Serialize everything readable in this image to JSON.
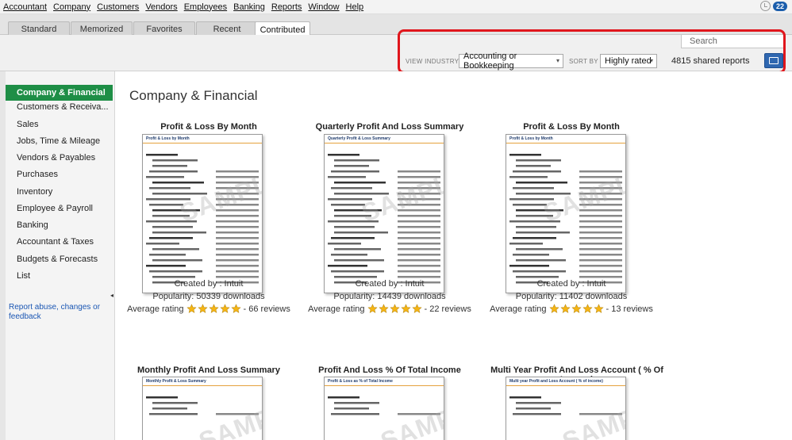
{
  "menu": [
    "Accountant",
    "Company",
    "Customers",
    "Vendors",
    "Employees",
    "Banking",
    "Reports",
    "Window",
    "Help"
  ],
  "notifications": {
    "count": "22"
  },
  "tabs": [
    "Standard",
    "Memorized",
    "Favorites",
    "Recent",
    "Contributed"
  ],
  "active_tab": "Contributed",
  "search": {
    "placeholder": "Search"
  },
  "filters": {
    "view_industry_label": "VIEW INDUSTRY",
    "view_industry_value": "Accounting or Bookkeeping",
    "sort_by_label": "SORT BY",
    "sort_by_value": "Highly rated",
    "shared_count": "4815 shared reports"
  },
  "sidebar": {
    "items": [
      {
        "label": "Company & Financial"
      },
      {
        "label": "Customers & Receiva..."
      },
      {
        "label": "Sales"
      },
      {
        "label": "Jobs, Time & Mileage"
      },
      {
        "label": "Vendors & Payables"
      },
      {
        "label": "Purchases"
      },
      {
        "label": "Inventory"
      },
      {
        "label": "Employee & Payroll"
      },
      {
        "label": "Banking"
      },
      {
        "label": "Accountant & Taxes"
      },
      {
        "label": "Budgets & Forecasts"
      },
      {
        "label": "List"
      }
    ],
    "active": "Company & Financial",
    "report_link": "Report abuse, changes or feedback"
  },
  "main": {
    "title": "Company & Financial",
    "cards": [
      {
        "title": "Profit & Loss By Month",
        "thumb_header": "Profit & Loss by Month",
        "created_by": "Created by : Intuit",
        "popularity": "Popularity:  50339 downloads",
        "rating_label": "Average rating",
        "rating": 5,
        "reviews": "- 66 reviews"
      },
      {
        "title": "Quarterly Profit And Loss Summary",
        "thumb_header": "Quarterly Profit & Loss Summary",
        "created_by": "Created by : Intuit",
        "popularity": "Popularity:  14439 downloads",
        "rating_label": "Average rating",
        "rating": 5,
        "reviews": "- 22 reviews"
      },
      {
        "title": "Profit & Loss By Month",
        "thumb_header": "Profit & Loss by Month",
        "created_by": "Created by : Intuit",
        "popularity": "Popularity:  11402 downloads",
        "rating_label": "Average rating",
        "rating": 5,
        "reviews": "- 13 reviews"
      },
      {
        "title": "Monthly Profit And Loss Summary",
        "thumb_header": "Monthly Profit & Loss Summary"
      },
      {
        "title": "Profit And Loss % Of Total Income",
        "thumb_header": "Profit & Loss as % of Total Income"
      },
      {
        "title": "Multi Year Profit And Loss Account ( % Of Income)",
        "thumb_header": "Multi year Profit and Loss Account ( % of income)"
      }
    ],
    "watermark": "SAMPLE"
  },
  "colors": {
    "accent": "#1e8e46",
    "highlight": "#e0161c",
    "star": "#f5b515",
    "link": "#1a56b3"
  }
}
